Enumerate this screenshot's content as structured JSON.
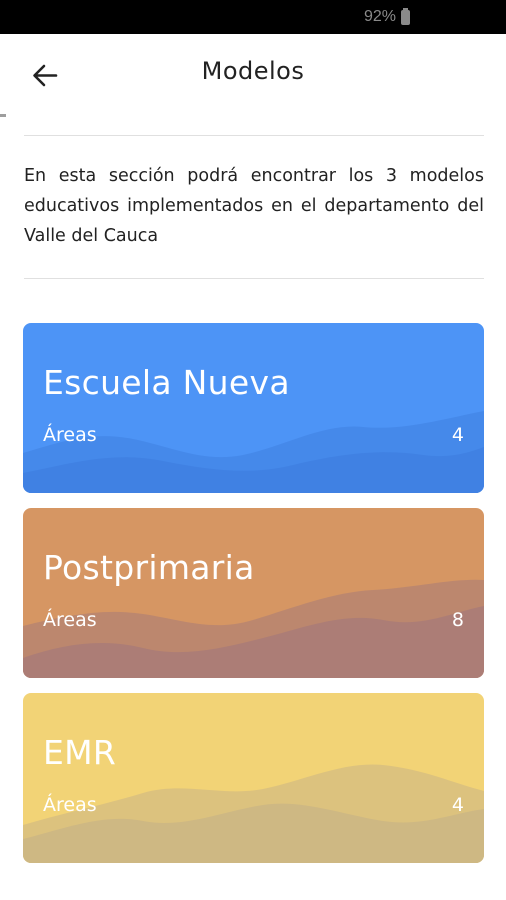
{
  "status_bar": {
    "battery_text": "92%",
    "battery_icon": "battery-icon"
  },
  "header": {
    "title": "Modelos",
    "back_icon": "arrow-left-icon"
  },
  "intro": {
    "text": "En esta sección podrá encontrar los 3 modelos educativos implementados en el departamento del Valle del Cauca"
  },
  "models": [
    {
      "title": "Escuela Nueva",
      "label": "Áreas",
      "count": "4",
      "color": "#4d94f6",
      "wave_color": "#3f7fe0"
    },
    {
      "title": "Postprimaria",
      "label": "Áreas",
      "count": "8",
      "color": "#d69663",
      "wave_color": "#a87b78"
    },
    {
      "title": "EMR",
      "label": "Áreas",
      "count": "4",
      "color": "#f2d376",
      "wave_color": "#cbb585"
    }
  ]
}
